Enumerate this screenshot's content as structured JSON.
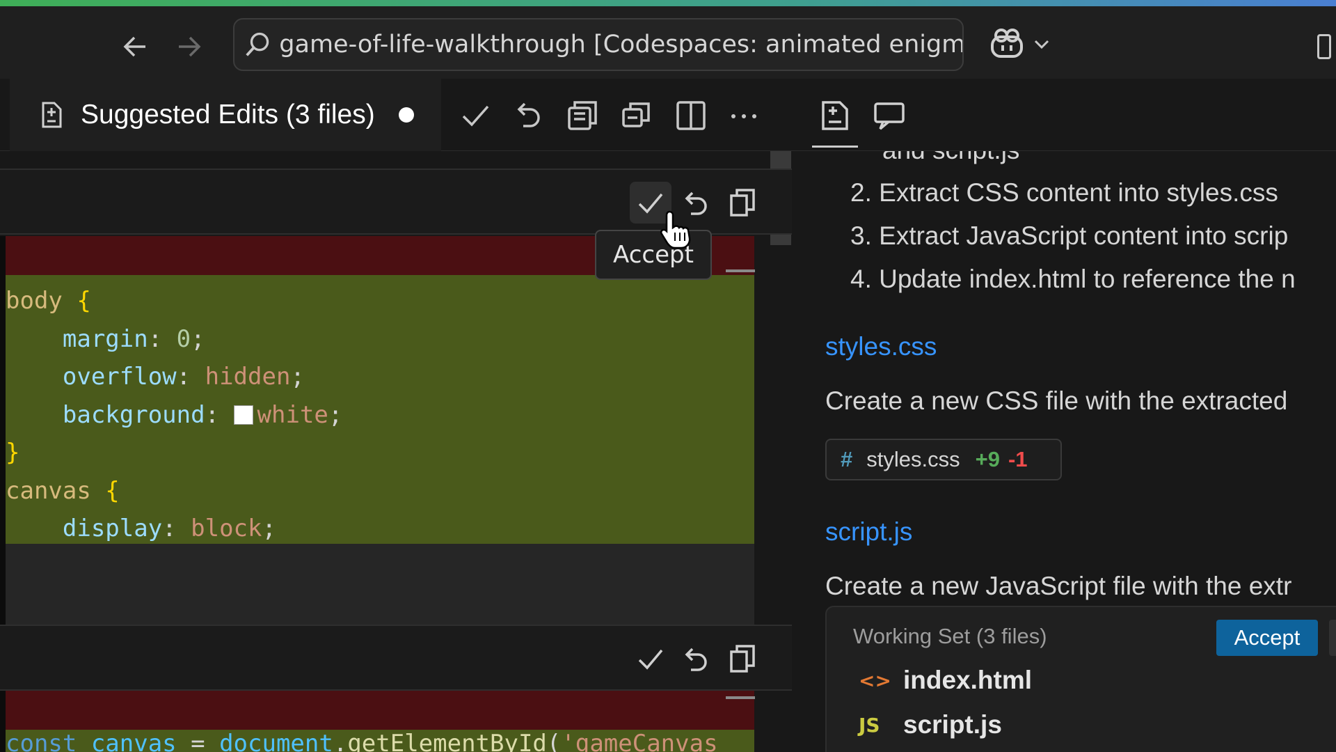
{
  "titlebar": {
    "command_center_text": "game-of-life-walkthrough [Codespaces: animated enigma]",
    "back_icon": "arrow-left-icon",
    "forward_icon": "arrow-right-icon",
    "copilot_icon": "copilot-icon"
  },
  "editor_tab": {
    "label": "Suggested Edits (3 files)",
    "dirty": true,
    "toolbar_icons": [
      "check-icon",
      "discard-icon",
      "open-file-icon",
      "copy-icon",
      "split-editor-icon",
      "more-icon"
    ]
  },
  "tooltip": {
    "text": "Accept"
  },
  "diff_hunk_1": {
    "lines": [
      [
        {
          "t": "body ",
          "c": "sel"
        },
        {
          "t": "{",
          "c": "brace"
        }
      ],
      [
        {
          "t": "    margin",
          "c": "prop"
        },
        {
          "t": ": ",
          "c": "punc"
        },
        {
          "t": "0",
          "c": "num"
        },
        {
          "t": ";",
          "c": "punc"
        }
      ],
      [
        {
          "t": "    overflow",
          "c": "prop"
        },
        {
          "t": ": ",
          "c": "punc"
        },
        {
          "t": "hidden",
          "c": "val"
        },
        {
          "t": ";",
          "c": "punc"
        }
      ],
      [
        {
          "t": "    background",
          "c": "prop"
        },
        {
          "t": ": ",
          "c": "punc"
        },
        {
          "t": "SWATCH",
          "c": "swatch"
        },
        {
          "t": "white",
          "c": "val"
        },
        {
          "t": ";",
          "c": "punc"
        }
      ],
      [
        {
          "t": "}",
          "c": "brace"
        }
      ],
      [
        {
          "t": "canvas ",
          "c": "sel"
        },
        {
          "t": "{",
          "c": "brace"
        }
      ],
      [
        {
          "t": "    display",
          "c": "prop"
        },
        {
          "t": ": ",
          "c": "punc"
        },
        {
          "t": "block",
          "c": "val"
        },
        {
          "t": ";",
          "c": "punc"
        }
      ],
      [
        {
          "t": "}",
          "c": "brace"
        }
      ]
    ]
  },
  "diff_hunk_2": {
    "first_line": [
      {
        "t": "const ",
        "c": "kw"
      },
      {
        "t": "canvas",
        "c": "var"
      },
      {
        "t": " = ",
        "c": "punc"
      },
      {
        "t": "document",
        "c": "var"
      },
      {
        "t": ".",
        "c": "punc"
      },
      {
        "t": "getElementById",
        "c": "fn"
      },
      {
        "t": "(",
        "c": "punc"
      },
      {
        "t": "'gameCanvas",
        "c": "val"
      }
    ]
  },
  "chat": {
    "partial_line": "and script.js",
    "steps": [
      "2. Extract CSS content into styles.css",
      "3. Extract JavaScript content into scrip",
      "4. Update index.html to reference the n"
    ],
    "styles_heading": "styles.css",
    "styles_desc": "Create a new CSS file with the extracted",
    "file_chip": {
      "name": "styles.css",
      "additions": "+9",
      "deletions": "-1"
    },
    "script_heading": "script.js",
    "script_desc": "Create a new JavaScript file with the extr"
  },
  "working_set": {
    "title": "Working Set (3 files)",
    "accept_label": "Accept",
    "files": [
      {
        "icon_text": "<>",
        "icon_color": "#e37933",
        "name": "index.html"
      },
      {
        "icon_text": "JS",
        "icon_color": "#cbcb41",
        "name": "script.js"
      }
    ]
  }
}
